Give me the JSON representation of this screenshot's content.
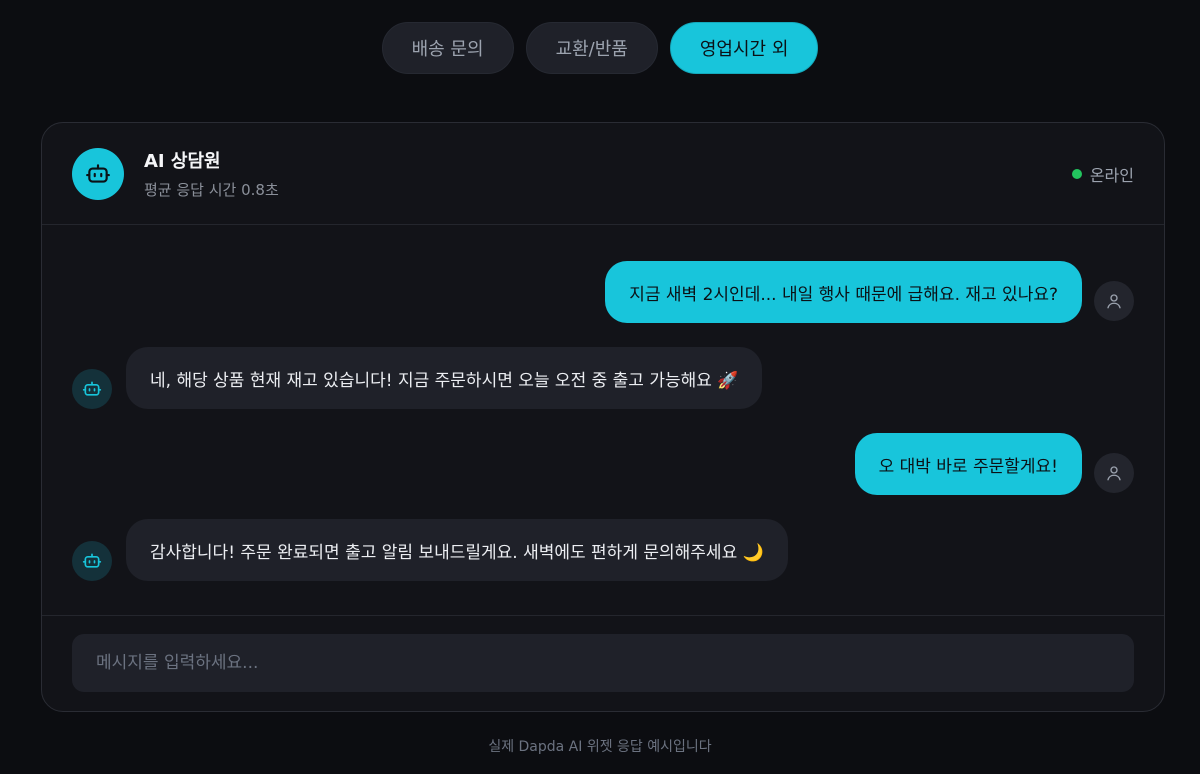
{
  "tabs": [
    {
      "label": "배송 문의",
      "active": false
    },
    {
      "label": "교환/반품",
      "active": false
    },
    {
      "label": "영업시간 외",
      "active": true
    }
  ],
  "header": {
    "icon": "robot-icon",
    "name": "AI 상담원",
    "subtitle": "평균 응답 시간 0.8초",
    "status": "온라인"
  },
  "messages": [
    {
      "sender": "user",
      "text": "지금 새벽 2시인데... 내일 행사 때문에 급해요. 재고 있나요?"
    },
    {
      "sender": "bot",
      "text": "네, 해당 상품 현재 재고 있습니다! 지금 주문하시면 오늘 오전 중 출고 가능해요 🚀"
    },
    {
      "sender": "user",
      "text": "오 대박 바로 주문할게요!"
    },
    {
      "sender": "bot",
      "text": "감사합니다! 주문 완료되면 출고 알림 보내드릴게요. 새벽에도 편하게 문의해주세요 🌙"
    }
  ],
  "input": {
    "placeholder": "메시지를 입력하세요...",
    "value": ""
  },
  "footnote": "실제 Dapda AI 위젯 응답 예시입니다",
  "colors": {
    "accent": "#18c5db",
    "online": "#22c55e",
    "background": "#0c0d11"
  }
}
